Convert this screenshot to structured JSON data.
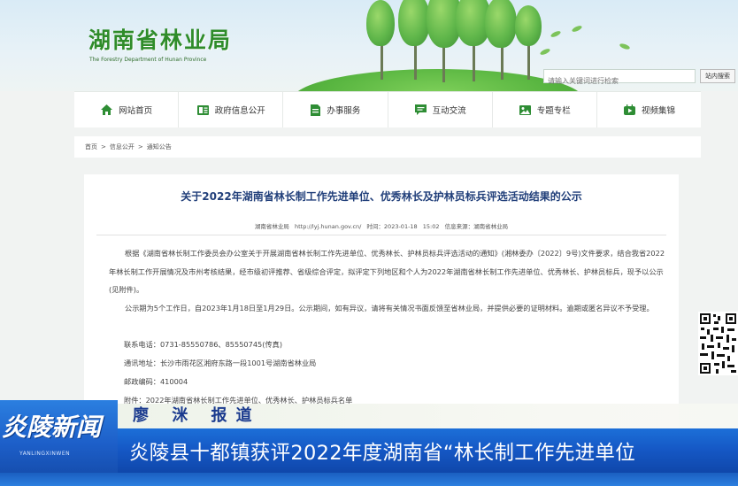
{
  "site": {
    "title": "湖南省林业局",
    "subtitle": "The Forestry Department of Hunan Province"
  },
  "search": {
    "placeholder": "请输入关键词进行检索",
    "button_label": "站内搜索"
  },
  "nav": {
    "items": [
      {
        "label": "网站首页",
        "icon": "home-icon"
      },
      {
        "label": "政府信息公开",
        "icon": "document-icon"
      },
      {
        "label": "办事服务",
        "icon": "file-icon"
      },
      {
        "label": "互动交流",
        "icon": "chat-icon"
      },
      {
        "label": "专题专栏",
        "icon": "image-icon"
      },
      {
        "label": "视频集锦",
        "icon": "video-icon"
      }
    ]
  },
  "breadcrumb": {
    "items": [
      "首页",
      "信息公开",
      "通知公告"
    ],
    "separator": ">"
  },
  "article": {
    "title": "关于2022年湖南省林长制工作先进单位、优秀林长及护林员标兵评选活动结果的公示",
    "meta": {
      "source": "湖南省林业局",
      "url": "http://lyj.hunan.gov.cn/",
      "time": "时间：2023-01-18 15:02",
      "source_label": "信息来源：湖南省林业局"
    },
    "paragraph1": "根据《湖南省林长制工作委员会办公室关于开展湖南省林长制工作先进单位、优秀林长、护林员标兵评选活动的通知》(湘林委办〔2022〕9号)文件要求，结合我省2022年林长制工作开展情况及市州考核结果，经市级初评推荐、省级综合评定，拟评定下列地区和个人为2022年湖南省林长制工作先进单位、优秀林长、护林员标兵，现予以公示(见附件)。",
    "paragraph2": "公示期为5个工作日，自2023年1月18日至1月29日。公示期间，如有异议，请将有关情况书面反馈至省林业局，并提供必要的证明材料。逾期或匿名异议不予受理。",
    "phone": "联系电话：0731-85550786、85550745(传真)",
    "address": "通讯地址：长沙市雨花区湘府东路一段1001号湖南省林业局",
    "postcode": "邮政编码：410004",
    "attachment": "附件：2022年湖南省林长制工作先进单位、优秀林长、护林员标兵名单"
  },
  "tv": {
    "reporter": "廖 洣 报道",
    "headline": "炎陵县十都镇获评2022年度湖南省“林长制工作先进单位",
    "logo": "炎陵新闻",
    "logo_sub": "YANLINGXINWEN"
  },
  "colors": {
    "site_title": "#2f8c2a",
    "article_title": "#213f7a",
    "tv_blue": "#1557c4",
    "reporter_text": "#1a3a8e"
  }
}
